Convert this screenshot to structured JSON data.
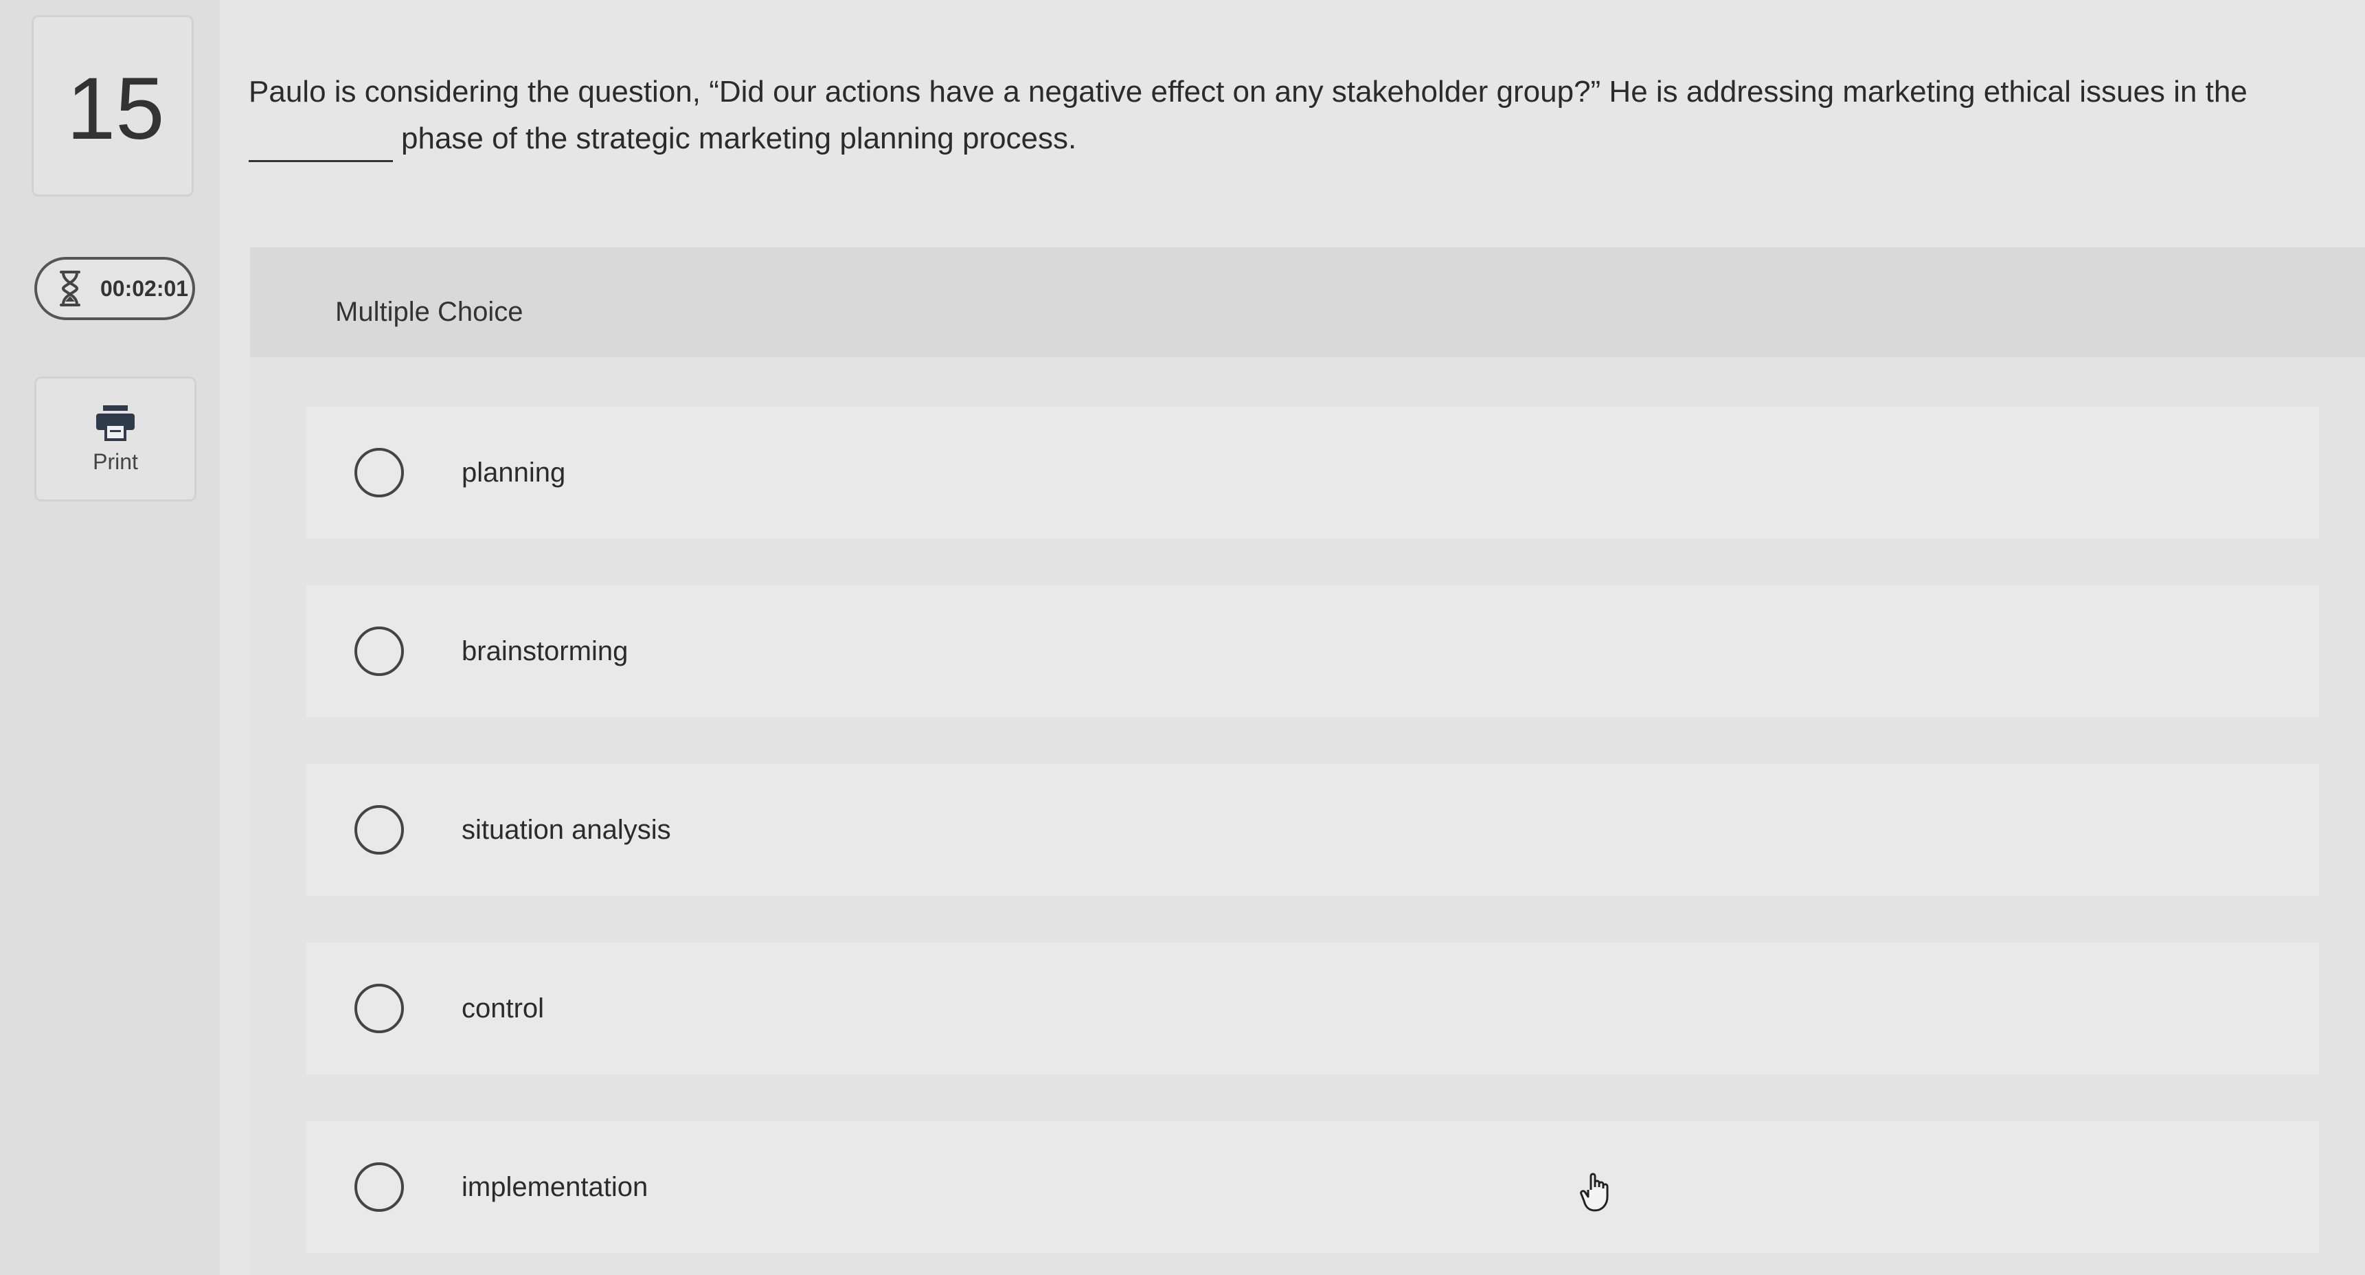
{
  "question": {
    "number": "15",
    "text_before": "Paulo is considering the question, “Did our actions have a negative effect on any stakeholder group?” He is addressing marketing ethical issues in the",
    "text_after": "phase of the strategic marketing planning process."
  },
  "timer": {
    "value": "00:02:01",
    "icon": "hourglass-icon"
  },
  "print": {
    "label": "Print",
    "icon": "printer-icon"
  },
  "answer_panel": {
    "type_label": "Multiple Choice",
    "selected": null,
    "choices": [
      {
        "label": "planning"
      },
      {
        "label": "brainstorming"
      },
      {
        "label": "situation analysis"
      },
      {
        "label": "control"
      },
      {
        "label": "implementation"
      }
    ]
  },
  "colors": {
    "background": "#e6e6e6",
    "text": "#2b2b2b",
    "outline": "#444444"
  }
}
